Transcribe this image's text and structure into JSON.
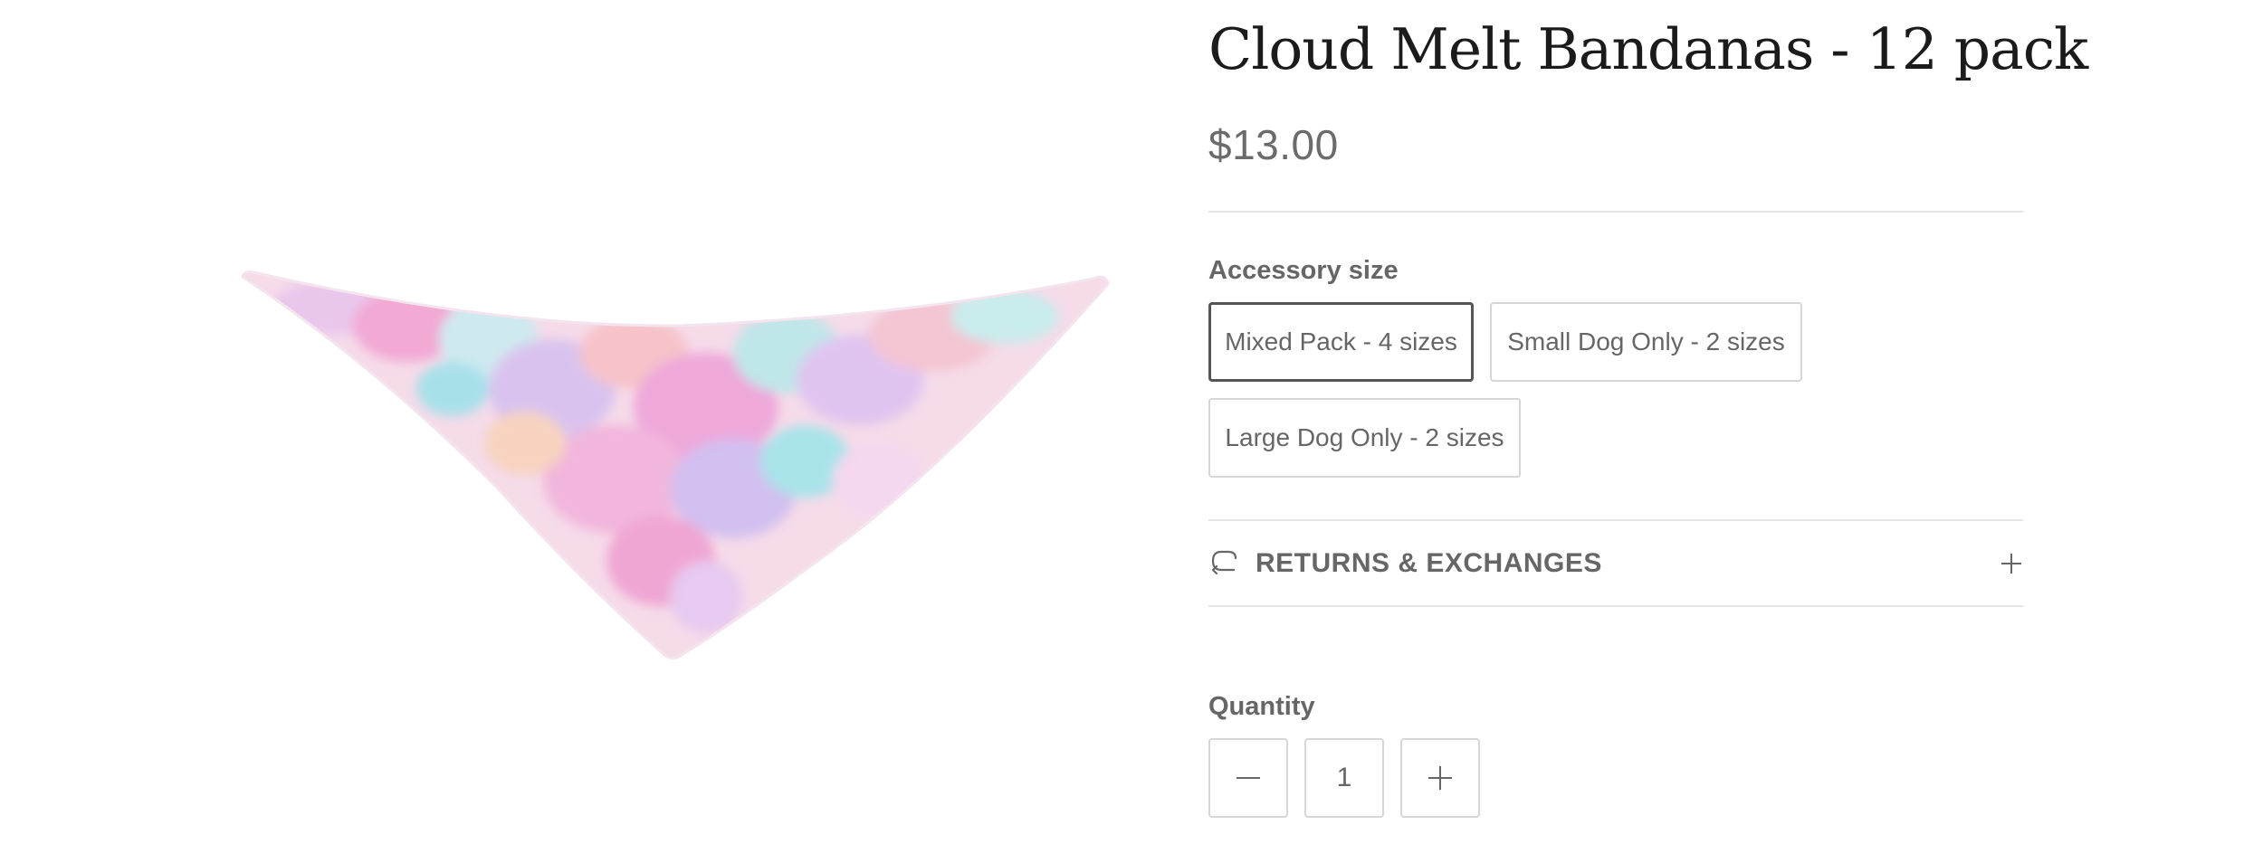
{
  "product": {
    "title": "Cloud Melt Bandanas - 12 pack",
    "price": "$13.00"
  },
  "options": {
    "label": "Accessory size",
    "values": [
      {
        "label": "Mixed Pack - 4 sizes",
        "selected": true
      },
      {
        "label": "Small Dog Only - 2 sizes",
        "selected": false
      },
      {
        "label": "Large Dog Only - 2 sizes",
        "selected": false
      }
    ]
  },
  "accordion": {
    "title": "RETURNS & EXCHANGES",
    "icon": "return-arrow-icon",
    "toggle_icon": "plus-icon"
  },
  "quantity": {
    "label": "Quantity",
    "value": "1",
    "decrease_icon": "minus-icon",
    "increase_icon": "plus-icon"
  },
  "colors": {
    "title": "#1b1b1b",
    "text": "#666666",
    "border": "#d6d6d6",
    "selected_border": "#555555",
    "divider": "#e6e6e6"
  }
}
